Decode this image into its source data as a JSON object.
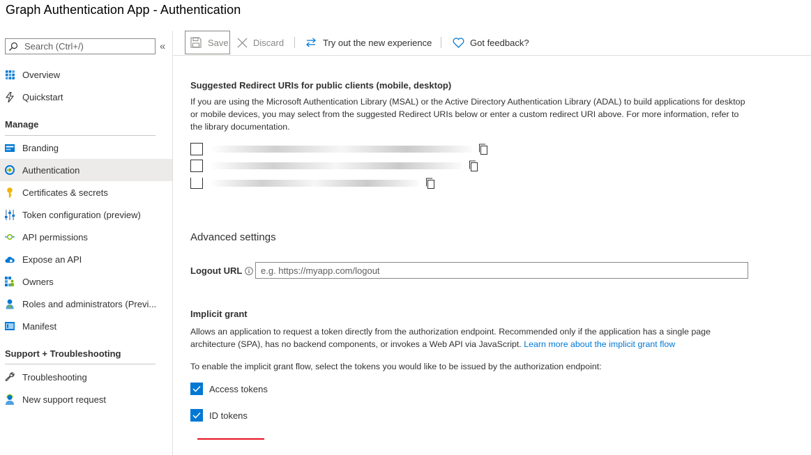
{
  "app": {
    "title": "Graph Authentication App - Authentication"
  },
  "sidebar": {
    "search_placeholder": "Search (Ctrl+/)",
    "collapse_glyph": "«",
    "top_items": [
      {
        "label": "Overview",
        "icon": "overview-grid-icon"
      },
      {
        "label": "Quickstart",
        "icon": "lightning-icon"
      }
    ],
    "manage_title": "Manage",
    "manage_items": [
      {
        "label": "Branding",
        "icon": "branding-icon"
      },
      {
        "label": "Authentication",
        "icon": "authentication-icon",
        "active": true
      },
      {
        "label": "Certificates & secrets",
        "icon": "key-icon"
      },
      {
        "label": "Token configuration (preview)",
        "icon": "token-config-icon"
      },
      {
        "label": "API permissions",
        "icon": "api-permissions-icon"
      },
      {
        "label": "Expose an API",
        "icon": "cloud-icon"
      },
      {
        "label": "Owners",
        "icon": "owners-icon"
      },
      {
        "label": "Roles and administrators (Previ...",
        "icon": "roles-icon"
      },
      {
        "label": "Manifest",
        "icon": "manifest-icon"
      }
    ],
    "support_title": "Support + Troubleshooting",
    "support_items": [
      {
        "label": "Troubleshooting",
        "icon": "wrench-icon"
      },
      {
        "label": "New support request",
        "icon": "support-person-icon"
      }
    ]
  },
  "toolbar": {
    "save_label": "Save",
    "discard_label": "Discard",
    "try_label": "Try out the new experience",
    "feedback_label": "Got feedback?"
  },
  "redirect": {
    "title": "Suggested Redirect URIs for public clients (mobile, desktop)",
    "description": "If you are using the Microsoft Authentication Library (MSAL) or the Active Directory Authentication Library (ADAL) to build applications for desktop or mobile devices, you may select from the suggested Redirect URIs below or enter a custom redirect URI above. For more information, refer to the library documentation.",
    "uris": [
      {
        "checked": false
      },
      {
        "checked": false
      },
      {
        "checked": false
      }
    ]
  },
  "advanced": {
    "title": "Advanced settings",
    "logout_label": "Logout URL",
    "logout_placeholder": "e.g. https://myapp.com/logout"
  },
  "implicit": {
    "title": "Implicit grant",
    "description": "Allows an application to request a token directly from the authorization endpoint. Recommended only if the application has a single page architecture (SPA), has no backend components, or invokes a Web API via JavaScript.",
    "link_text": "Learn more about the implicit grant flow",
    "instruction": "To enable the implicit grant flow, select the tokens you would like to be issued by the authorization endpoint:",
    "tokens": [
      {
        "label": "Access tokens",
        "checked": true
      },
      {
        "label": "ID tokens",
        "checked": true
      }
    ]
  },
  "colors": {
    "accent": "#0078d4",
    "active_bg": "#edebe9",
    "annotation_red": "#e81123"
  }
}
